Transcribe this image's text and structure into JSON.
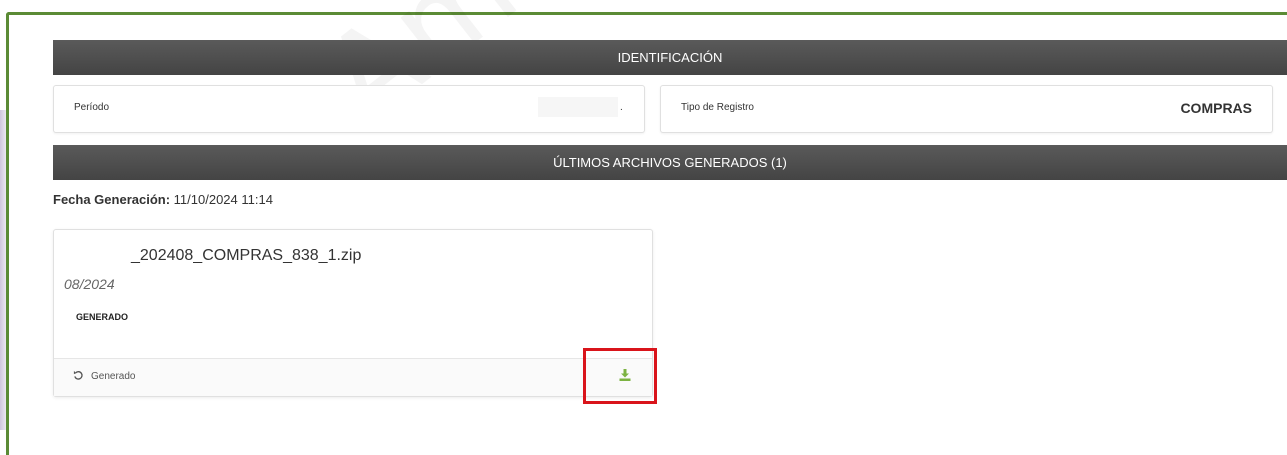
{
  "watermark": "Ambiente de Pruebas",
  "identificacion": {
    "header": "IDENTIFICACIÓN",
    "periodo_label": "Período",
    "periodo_value": ".",
    "tipo_label": "Tipo de Registro",
    "tipo_value": "COMPRAS"
  },
  "archivos": {
    "header": "ÚLTIMOS ARCHIVOS GENERADOS (1)",
    "fecha_label": "Fecha Generación:",
    "fecha_value": "11/10/2024 11:14",
    "file": {
      "name": "_202408_COMPRAS_838_1.zip",
      "period": "08/2024",
      "status": "GENERADO",
      "footer_text": "Generado",
      "footer_icon": "history-icon",
      "download_icon": "download-icon"
    }
  },
  "colors": {
    "border_green": "#5b8b35",
    "header_bar": "#4d4d4d",
    "download_green": "#7cb342",
    "highlight_red": "#d9141b"
  }
}
